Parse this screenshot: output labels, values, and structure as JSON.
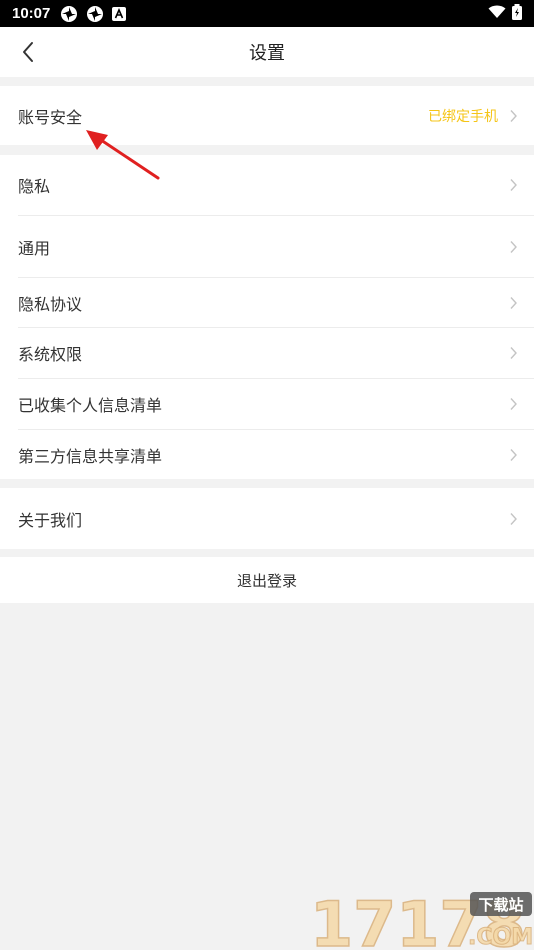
{
  "status_bar": {
    "time": "10:07",
    "icons": [
      "pinwheel-icon",
      "pinwheel-icon",
      "a-badge-icon",
      "wifi-icon",
      "battery-charging-icon"
    ]
  },
  "nav": {
    "title": "设置",
    "back_icon": "chevron-left-icon"
  },
  "sections": {
    "account": {
      "label": "账号安全",
      "value": "已绑定手机",
      "value_color": "#f5c518"
    },
    "privacy_items": [
      {
        "label": "隐私"
      },
      {
        "label": "通用"
      },
      {
        "label": "隐私协议"
      },
      {
        "label": "系统权限"
      },
      {
        "label": "已收集个人信息清单"
      },
      {
        "label": "第三方信息共享清单"
      }
    ],
    "about": {
      "label": "关于我们"
    }
  },
  "logout": {
    "label": "退出登录"
  },
  "annotation": {
    "icon": "red-arrow-icon",
    "color": "#e02020"
  },
  "watermark": {
    "text": "17178",
    "sub": "下载站",
    "domain": ".COM"
  }
}
